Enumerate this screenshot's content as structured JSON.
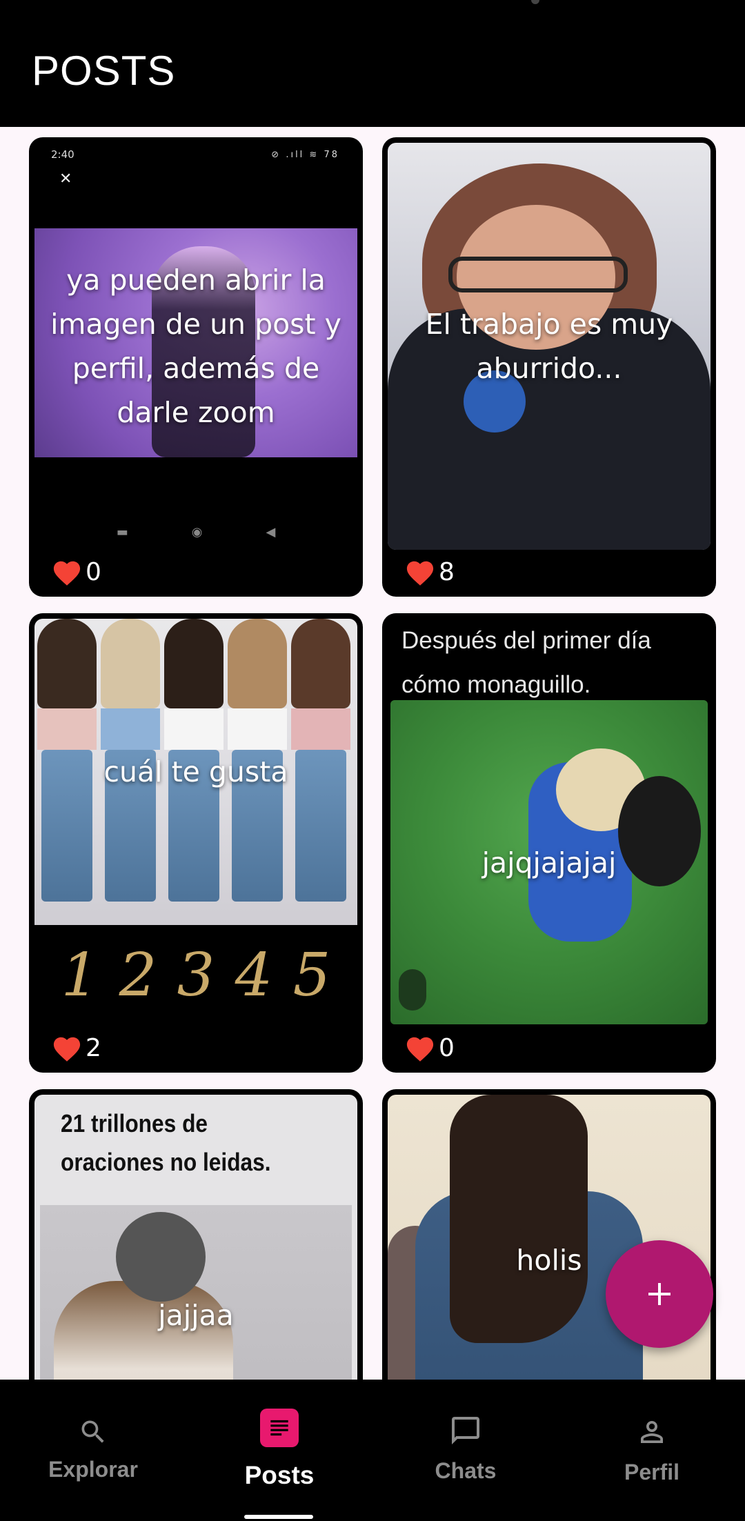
{
  "app_bar": {
    "title": "POSTS"
  },
  "posts": [
    {
      "caption": "ya pueden abrir la imagen de un post y perfil, además de darle zoom",
      "likes": "0",
      "image": {
        "time": "2:40",
        "status_icons": "⊘ .ıll ≋ 78",
        "close_glyph": "✕"
      }
    },
    {
      "caption": "El trabajo es muy aburrido...",
      "likes": "8"
    },
    {
      "caption": "cuál te gusta",
      "likes": "2",
      "image": {
        "numbers": [
          "1",
          "2",
          "3",
          "4",
          "5"
        ]
      }
    },
    {
      "caption": "jajqjajajaj",
      "likes": "0",
      "image": {
        "text": "Después del primer día cómo monaguillo."
      }
    },
    {
      "caption": "jajjaa",
      "likes": "",
      "image": {
        "text": "21 trillones de oraciones no leidas."
      }
    },
    {
      "caption": "holis",
      "likes": ""
    }
  ],
  "fab": {
    "icon": "plus-icon"
  },
  "bottom_nav": {
    "items": [
      {
        "label": "Explorar",
        "icon": "search-icon"
      },
      {
        "label": "Posts",
        "icon": "article-icon",
        "active": true
      },
      {
        "label": "Chats",
        "icon": "chat-bubble-icon"
      },
      {
        "label": "Perfil",
        "icon": "person-icon"
      }
    ]
  },
  "colors": {
    "accent": "#e8196e",
    "fab": "#b0186f",
    "like": "#f44336"
  }
}
